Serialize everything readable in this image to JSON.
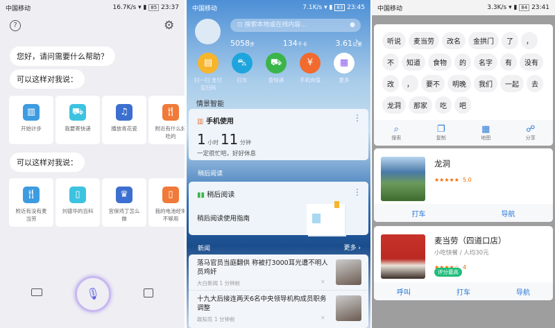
{
  "panel1": {
    "status": {
      "carrier": "中国移动",
      "speed": "16.7K/s",
      "battery": "85",
      "time": "23:37"
    },
    "greeting": "您好，请问需要什么帮助？",
    "prompt1": "可以这样对我说：",
    "prompt2": "可以这样对我说：",
    "row1": [
      {
        "label": "开始计步",
        "icon": "chart-icon",
        "color": "#3d9be0"
      },
      {
        "label": "我要寄快递",
        "icon": "truck-icon",
        "color": "#3cc3e0"
      },
      {
        "label": "播放青花瓷",
        "icon": "music-icon",
        "color": "#3c6fcf"
      },
      {
        "label": "附近有什么好吃的",
        "icon": "fork-knife-icon",
        "color": "#f07a3a"
      }
    ],
    "row2": [
      {
        "label": "附近有没有麦当劳",
        "icon": "fork-knife-icon",
        "color": "#3d9be0"
      },
      {
        "label": "刘德华的百科",
        "icon": "book-icon",
        "color": "#3cc3e0"
      },
      {
        "label": "宫保鸡丁怎么做",
        "icon": "chef-hat-icon",
        "color": "#3c6fcf"
      },
      {
        "label": "我的电池经常不够用",
        "icon": "phone-icon",
        "color": "#f07a3a"
      }
    ]
  },
  "panel2": {
    "status": {
      "carrier": "中国移动",
      "speed": "7.1K/s",
      "battery": "83",
      "time": "23:45"
    },
    "search_placeholder": "搜索本地或在线内容...",
    "stats": [
      {
        "value": "5058",
        "unit": "步"
      },
      {
        "value": "134",
        "unit": "千卡"
      },
      {
        "value": "3.61",
        "unit": "公里"
      }
    ],
    "shortcuts": [
      {
        "label": "扫一扫 支付宝扫码",
        "color": "#f7b52c"
      },
      {
        "label": "打车",
        "color": "#1fa5dd"
      },
      {
        "label": "查快递",
        "color": "#3bb54a"
      },
      {
        "label": "手机充值",
        "color": "#f26a2e"
      },
      {
        "label": "更多",
        "color": "#ffffff"
      }
    ],
    "section_smart": "情景智能",
    "usage": {
      "title": "手机使用",
      "hours": "1",
      "hours_unit": "小时",
      "minutes": "11",
      "minutes_unit": "分钟",
      "note": "一定很忙吧，好好休息"
    },
    "section_later": "稍后阅读",
    "later": {
      "title": "稍后阅读",
      "item": "稍后阅读使用指南"
    },
    "section_news": "新闻",
    "more": "更多",
    "news": [
      {
        "title": "落马官员当庭翻供 称被打3000耳光遭不明人员鸡奸",
        "meta": "大白新闻 1 分钟前"
      },
      {
        "title": "十九大后接连两天6名中央领导机构成员职务调整",
        "meta": "政知见 1 分钟前"
      }
    ]
  },
  "panel3": {
    "status": {
      "carrier": "中国移动",
      "speed": "3.3K/s",
      "battery": "84",
      "time": "23:41"
    },
    "chips": [
      "听说",
      "麦当劳",
      "改名",
      "金拱门",
      "了",
      "，",
      "不",
      "知道",
      "食物",
      "的",
      "名字",
      "有",
      "没有",
      "改",
      "，",
      "要不",
      "明晚",
      "我们",
      "一起",
      "去",
      "龙洞",
      "那家",
      "吃",
      "吧"
    ],
    "tools": [
      {
        "label": "搜索",
        "icon": "search-icon"
      },
      {
        "label": "复制",
        "icon": "copy-icon"
      },
      {
        "label": "地图",
        "icon": "map-icon"
      },
      {
        "label": "分享",
        "icon": "share-icon"
      }
    ],
    "place1": {
      "name": "龙洞",
      "rating": "5.0",
      "stars": 5,
      "actions": [
        "打车",
        "导航"
      ]
    },
    "place2": {
      "name": "麦当劳（四道口店）",
      "desc": "小吃快餐 / 人均30元",
      "rating": "4",
      "stars": 4,
      "badge": "评分最高",
      "actions": [
        "呼叫",
        "打车",
        "导航"
      ]
    }
  }
}
